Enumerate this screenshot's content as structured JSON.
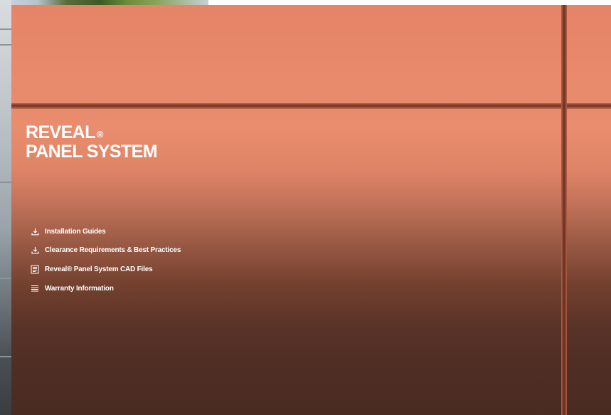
{
  "title": {
    "line1": "REVEAL",
    "registered": "®",
    "line2": "PANEL SYSTEM"
  },
  "links": [
    {
      "label": "Installation Guides",
      "icon": "download-icon"
    },
    {
      "label": "Clearance Requirements & Best Practices",
      "icon": "download-icon"
    },
    {
      "label": "Reveal® Panel System CAD Files",
      "icon": "document-icon"
    },
    {
      "label": "Warranty Information",
      "icon": "list-icon"
    }
  ],
  "colors": {
    "panel_top": "#e58467",
    "panel_bottom": "#4a2b22",
    "text": "#ffffff"
  }
}
